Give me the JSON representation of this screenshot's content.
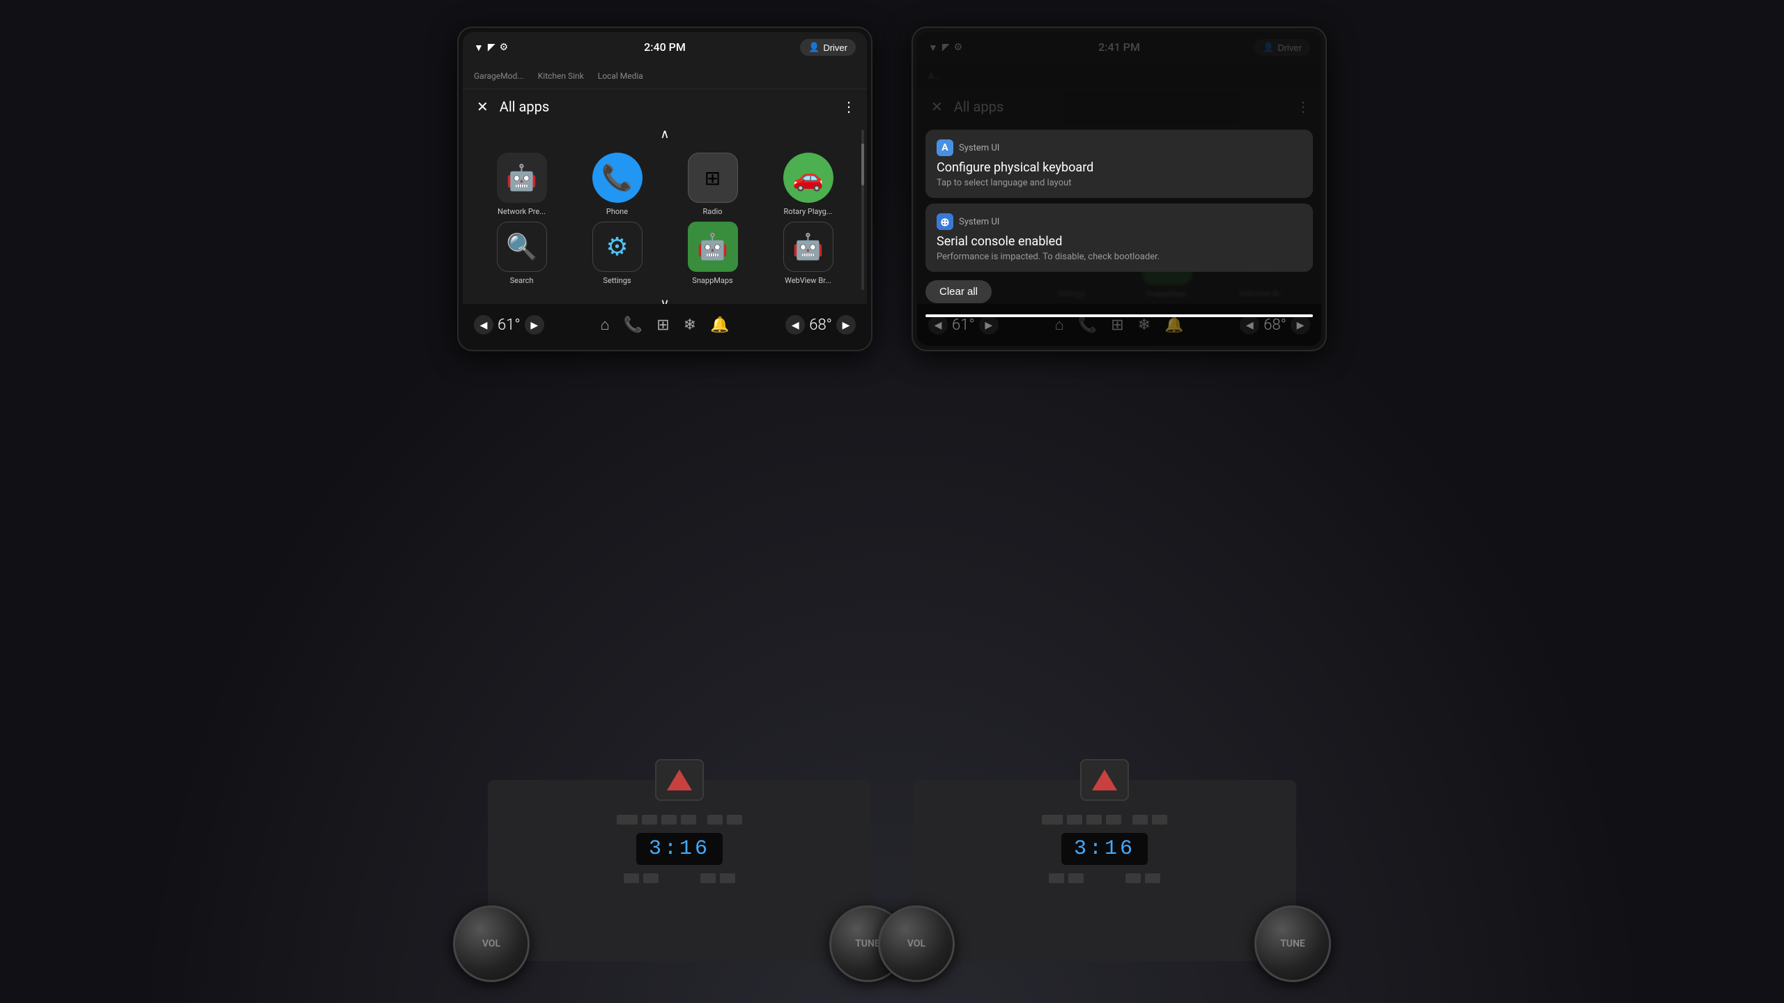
{
  "dashboard": {
    "background_color": "#1a1a1f"
  },
  "left_screen": {
    "status_bar": {
      "time": "2:40 PM",
      "driver_label": "Driver"
    },
    "tabs": [
      "GarageMod...",
      "Kitchen Sink",
      "Local Media"
    ],
    "header": {
      "title": "All apps",
      "close_icon": "×",
      "more_icon": "⋮"
    },
    "apps": [
      {
        "name": "Network Pre...",
        "icon_type": "android",
        "color": "#2a2a2a"
      },
      {
        "name": "Phone",
        "icon_type": "phone",
        "color": "#2196F3"
      },
      {
        "name": "Radio",
        "icon_type": "radio",
        "color": "#333"
      },
      {
        "name": "Rotary Playg...",
        "icon_type": "car",
        "color": "#4CAF50"
      },
      {
        "name": "Search",
        "icon_type": "search",
        "color": "#1c1c1c"
      },
      {
        "name": "Settings",
        "icon_type": "settings",
        "color": "#1c1c1c"
      },
      {
        "name": "SnappMaps",
        "icon_type": "snapp",
        "color": "#4CAF50"
      },
      {
        "name": "WebView Br...",
        "icon_type": "android2",
        "color": "#1c1c1c"
      }
    ],
    "bottom_bar": {
      "temp_left": "61°",
      "temp_right": "68°"
    }
  },
  "right_screen": {
    "status_bar": {
      "time": "2:41 PM",
      "driver_label": "Driver"
    },
    "header": {
      "title": "All apps"
    },
    "notifications": [
      {
        "app": "System UI",
        "icon_letter": "A",
        "icon_color": "#4a90e2",
        "title": "Configure physical keyboard",
        "body": "Tap to select language and layout"
      },
      {
        "app": "System UI",
        "icon_letter": "⊕",
        "icon_color": "#4a90e2",
        "title": "Serial console enabled",
        "body": "Performance is impacted. To disable, check bootloader."
      }
    ],
    "clear_all_label": "Clear all",
    "bottom_bar": {
      "temp_left": "61°",
      "temp_right": "68°"
    }
  },
  "physical": {
    "left_panel": {
      "vol_label": "VOL",
      "tune_label": "TUNE",
      "time_display": "3:16"
    },
    "right_panel": {
      "vol_label": "VOL",
      "tune_label": "TUNE",
      "time_display": "3:16"
    }
  }
}
